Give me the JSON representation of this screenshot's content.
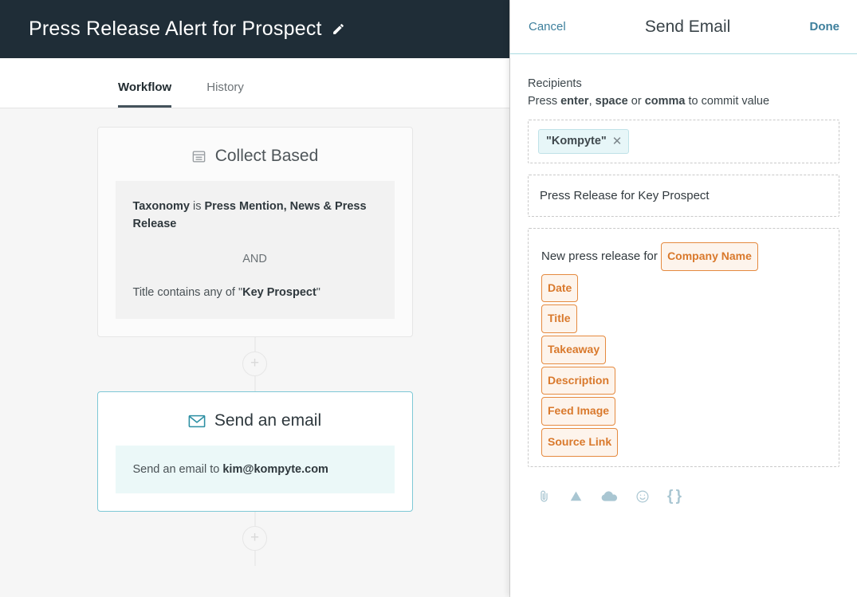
{
  "header": {
    "title": "Press Release Alert for Prospect",
    "edit_icon": "pencil-icon",
    "background_color": "#1f2d37"
  },
  "tabs": [
    {
      "label": "Workflow",
      "active": true
    },
    {
      "label": "History",
      "active": false
    }
  ],
  "workflow": {
    "nodes": [
      {
        "icon": "list-icon",
        "title": "Collect Based",
        "selected": false,
        "conditions": {
          "line1_prefix": "Taxonomy",
          "line1_mid": " is ",
          "line1_values": "Press Mention, News & Press Release",
          "operator": "AND",
          "line2_prefix": "Title contains any of \"",
          "line2_value": "Key Prospect",
          "line2_suffix": "\""
        }
      },
      {
        "icon": "envelope-icon",
        "title": "Send an email",
        "selected": true,
        "summary_prefix": "Send an email to ",
        "summary_value": "kim@kompyte.com"
      }
    ],
    "add_step_label": "+"
  },
  "panel": {
    "cancel_label": "Cancel",
    "title": "Send Email",
    "done_label": "Done",
    "accent_color": "#3d7f9c",
    "recipients": {
      "label": "Recipients",
      "hint_prefix": "Press ",
      "hint_key1": "enter",
      "hint_sep1": ", ",
      "hint_key2": "space",
      "hint_sep2": " or ",
      "hint_key3": "comma",
      "hint_suffix": " to commit value",
      "chips": [
        {
          "label": "\"Kompyte\"",
          "remove_icon": "close-icon"
        }
      ]
    },
    "subject": {
      "value": "Press Release for Key Prospect"
    },
    "message": {
      "text_before_token": "New press release for ",
      "inline_token": "Company Name",
      "tokens": [
        "Date",
        "Title",
        "Takeaway",
        "Description",
        "Feed Image",
        "Source Link"
      ],
      "token_color": "#d9792c",
      "token_border_color": "#e58a3f"
    },
    "toolbar": [
      {
        "icon": "attachment-icon"
      },
      {
        "icon": "google-drive-icon"
      },
      {
        "icon": "cloud-upload-icon"
      },
      {
        "icon": "emoji-icon"
      },
      {
        "icon": "variable-braces-icon"
      }
    ]
  }
}
